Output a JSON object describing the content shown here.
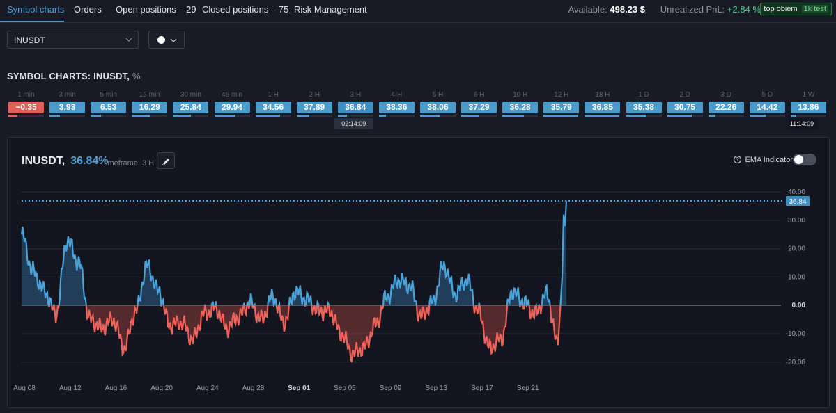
{
  "nav": {
    "tabs": [
      "Symbol charts",
      "Orders",
      "Open positions – 29",
      "Closed positions – 75",
      "Risk Management"
    ],
    "available_label": "Available:",
    "available_value": "498.23 $",
    "pnl_label": "Unrealized PnL:",
    "pnl_value": "+2.84 %",
    "badge_name": "top obiem",
    "badge_tag": "1k test"
  },
  "controls": {
    "symbol": "INUSDT",
    "color": "#ffffff"
  },
  "section_title": "SYMBOL CHARTS: INUSDT,",
  "section_unit": "%",
  "timeframes": [
    {
      "label": "1 min",
      "value": "−0.35",
      "negative": true,
      "fill": 0.25
    },
    {
      "label": "3 min",
      "value": "3.93",
      "fill": 0.3
    },
    {
      "label": "5 min",
      "value": "6.53",
      "fill": 0.3
    },
    {
      "label": "15 min",
      "value": "16.29",
      "fill": 0.5
    },
    {
      "label": "30 min",
      "value": "25.84",
      "fill": 0.5
    },
    {
      "label": "45 min",
      "value": "29.94",
      "fill": 0.6
    },
    {
      "label": "1 H",
      "value": "34.56",
      "fill": 0.7
    },
    {
      "label": "2 H",
      "value": "37.89",
      "fill": 0.35
    },
    {
      "label": "3 H",
      "value": "36.84",
      "fill": 0.25
    },
    {
      "label": "4 H",
      "value": "38.36",
      "fill": 0.2
    },
    {
      "label": "5 H",
      "value": "38.06",
      "fill": 0.55
    },
    {
      "label": "6 H",
      "value": "37.29",
      "fill": 0.5
    },
    {
      "label": "10 H",
      "value": "36.28",
      "fill": 0.6
    },
    {
      "label": "12 H",
      "value": "35.79",
      "fill": 0.95
    },
    {
      "label": "18 H",
      "value": "36.85",
      "fill": 0.95
    },
    {
      "label": "1 D",
      "value": "35.38",
      "fill": 0.55
    },
    {
      "label": "2 D",
      "value": "30.75",
      "fill": 0.7
    },
    {
      "label": "3 D",
      "value": "22.26",
      "fill": 0.2
    },
    {
      "label": "5 D",
      "value": "14.42",
      "fill": 0.45
    },
    {
      "label": "1 W",
      "value": "13.86",
      "fill": 0.15
    }
  ],
  "tooltips": {
    "selected": "02:14:09",
    "last": "11:14:09"
  },
  "chart": {
    "symbol": "INUSDT,",
    "current_pct": "36.84%",
    "timeframe_label": "timeframe: 3 H",
    "ema_label": "EMA Indicator",
    "help_glyph": "?",
    "current_value_label": "36.84"
  },
  "chart_data": {
    "type": "area",
    "ylim": [
      -23,
      42
    ],
    "yticks": [
      "40.00",
      "30.00",
      "20.00",
      "10.00",
      "0.00",
      "-10.00",
      "-20.00"
    ],
    "xticks": [
      "Aug 08",
      "Aug 12",
      "Aug 16",
      "Aug 20",
      "Aug 24",
      "Aug 28",
      "Sep 01",
      "Sep 05",
      "Sep 09",
      "Sep 13",
      "Sep 17",
      "Sep 21"
    ],
    "current_value": 36.84,
    "x": [
      "Aug 08",
      "Aug 09",
      "Aug 10",
      "Aug 11",
      "Aug 12",
      "Aug 13",
      "Aug 14",
      "Aug 15",
      "Aug 16",
      "Aug 17",
      "Aug 18",
      "Aug 19",
      "Aug 20",
      "Aug 21",
      "Aug 22",
      "Aug 23",
      "Aug 24",
      "Aug 25",
      "Aug 26",
      "Aug 27",
      "Aug 28",
      "Aug 29",
      "Aug 30",
      "Aug 31",
      "Sep 01",
      "Sep 02",
      "Sep 03",
      "Sep 04",
      "Sep 05",
      "Sep 06",
      "Sep 07",
      "Sep 08",
      "Sep 09",
      "Sep 10",
      "Sep 11",
      "Sep 12",
      "Sep 13",
      "Sep 14",
      "Sep 15",
      "Sep 16",
      "Sep 17",
      "Sep 18",
      "Sep 19",
      "Sep 20",
      "Sep 21",
      "Sep 22",
      "Sep 23",
      "Sep 24"
    ],
    "values": [
      25,
      12,
      5,
      -3,
      23,
      15,
      -5,
      -8,
      -5,
      -15,
      -2,
      14,
      5,
      -7,
      -6,
      -12,
      -3,
      -1,
      -8,
      -4,
      1,
      -5,
      3,
      -6,
      5,
      2,
      -2,
      -2,
      -10,
      -17,
      -15,
      -7,
      3,
      9,
      7,
      -4,
      1,
      14,
      4,
      9,
      -2,
      -15,
      -12,
      5,
      1,
      -3,
      4,
      -14
    ]
  }
}
